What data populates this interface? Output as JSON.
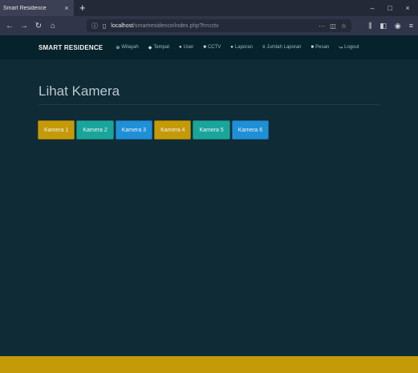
{
  "browser": {
    "tab_title": "Smart Residence",
    "tab_close": "×",
    "new_tab": "+",
    "win_min": "–",
    "win_max": "□",
    "win_close": "×",
    "nav_back": "←",
    "nav_forward": "→",
    "nav_reload": "↻",
    "nav_home": "⌂",
    "url_host": "localhost",
    "url_path": "/smartresidence/index.php?h=cctv",
    "url_more": "···",
    "url_pocket": "◫",
    "url_bookmark": "☆",
    "tool_library": "⫼",
    "tool_sidebar": "◧",
    "tool_account": "◉",
    "tool_menu": "≡"
  },
  "site_nav": {
    "brand": "SMART RESIDENCE",
    "items": [
      {
        "icon": "globe-icon",
        "glyph": "⊕",
        "label": "Wilayah"
      },
      {
        "icon": "pin-icon",
        "glyph": "◆",
        "label": "Tempat"
      },
      {
        "icon": "user-icon",
        "glyph": "●",
        "label": "User"
      },
      {
        "icon": "camera-icon",
        "glyph": "■",
        "label": "CCTV"
      },
      {
        "icon": "info-icon",
        "glyph": "●",
        "label": "Laporan"
      },
      {
        "icon": "list-icon",
        "glyph": "≡",
        "label": "Jumlah Laporan"
      },
      {
        "icon": "message-icon",
        "glyph": "■",
        "label": "Pesan"
      },
      {
        "icon": "logout-icon",
        "glyph": "↪",
        "label": "Logout"
      }
    ]
  },
  "page": {
    "title": "Lihat Kamera"
  },
  "cameras": [
    {
      "label": "Kamera 1",
      "color": "#c49a08"
    },
    {
      "label": "Kamera 2",
      "color": "#1aa59b"
    },
    {
      "label": "Kamera 3",
      "color": "#1f8fd6"
    },
    {
      "label": "Kamera 4",
      "color": "#c49a08"
    },
    {
      "label": "Kamera 5",
      "color": "#1aa59b"
    },
    {
      "label": "Kamera 6",
      "color": "#1f8fd6"
    }
  ],
  "colors": {
    "background": "#0f2b35",
    "navbar": "#06222b",
    "footer": "#c49a08"
  }
}
